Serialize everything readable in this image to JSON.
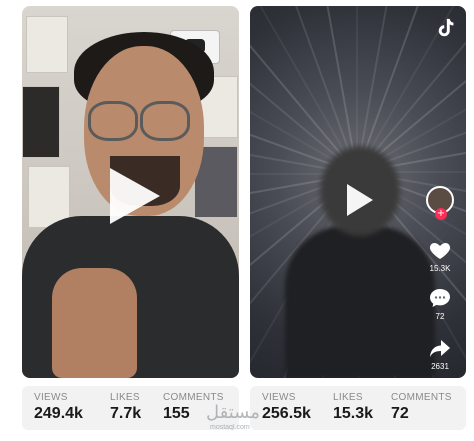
{
  "cards": [
    {
      "stats": {
        "views_label": "VIEWS",
        "views_value": "249.4k",
        "likes_label": "LIKES",
        "likes_value": "7.7k",
        "comments_label": "COMMENTS",
        "comments_value": "155"
      }
    },
    {
      "stats": {
        "views_label": "VIEWS",
        "views_value": "256.5k",
        "likes_label": "LIKES",
        "likes_value": "15.3k",
        "comments_label": "COMMENTS",
        "comments_value": "72"
      },
      "rail": {
        "likes_count": "15.3K",
        "comments_count": "72",
        "shares_count": "2631"
      }
    }
  ],
  "icons": {
    "play": "play-icon",
    "tiktok": "tiktok-logo-icon",
    "heart": "heart-icon",
    "comment": "comment-bubble-icon",
    "share": "share-arrow-icon"
  },
  "colors": {
    "accent": "#fe2c55",
    "panel": "#f2f2f2"
  },
  "watermark": {
    "text": "مستقل",
    "sub": "mostaql.com"
  }
}
